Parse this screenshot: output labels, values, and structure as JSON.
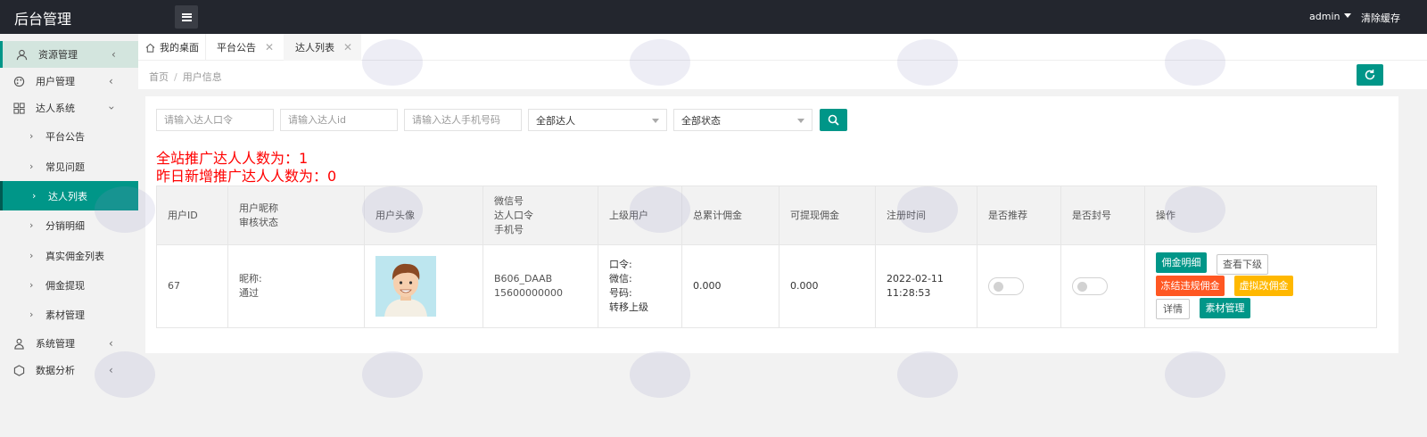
{
  "app": {
    "title": "后台管理",
    "user": "admin",
    "clear_cache": "清除缓存"
  },
  "sidebar": {
    "items": [
      {
        "label": "资源管理",
        "icon": "user-icon"
      },
      {
        "label": "用户管理",
        "icon": "palette-icon"
      },
      {
        "label": "达人系统",
        "icon": "grid-icon"
      }
    ],
    "sub_items": [
      {
        "label": "平台公告"
      },
      {
        "label": "常见问题"
      },
      {
        "label": "达人列表"
      },
      {
        "label": "分销明细"
      },
      {
        "label": "真实佣金列表"
      },
      {
        "label": "佣金提现"
      },
      {
        "label": "素材管理"
      }
    ],
    "bottom_items": [
      {
        "label": "系统管理",
        "icon": "person-icon"
      },
      {
        "label": "数据分析",
        "icon": "hexagon-icon"
      }
    ]
  },
  "tabs": [
    {
      "label": "我的桌面"
    },
    {
      "label": "平台公告"
    },
    {
      "label": "达人列表"
    }
  ],
  "breadcrumb": {
    "home": "首页",
    "current": "用户信息"
  },
  "filters": {
    "token_placeholder": "请输入达人口令",
    "id_placeholder": "请输入达人id",
    "phone_placeholder": "请输入达人手机号码",
    "type_select": "全部达人",
    "status_select": "全部状态"
  },
  "stats": {
    "total": "全站推广达人人数为：1",
    "yesterday": "昨日新增推广达人人数为：0"
  },
  "table": {
    "headers": {
      "user_id": "用户ID",
      "nickname_1": "用户昵称",
      "nickname_2": "审核状态",
      "avatar": "用户头像",
      "wx_1": "微信号",
      "wx_2": "达人口令",
      "wx_3": "手机号",
      "parent": "上级用户",
      "total": "总累计佣金",
      "withdrawable": "可提现佣金",
      "reg_time": "注册时间",
      "recommend": "是否推荐",
      "banned": "是否封号",
      "ops": "操作"
    },
    "rows": [
      {
        "user_id": "67",
        "nickname": "昵称:",
        "status": "通过",
        "token": "B606_DAAB",
        "phone": "15600000000",
        "parent_token": "口令:",
        "parent_wx": "微信:",
        "parent_phone": "号码:",
        "parent_transfer": "转移上级",
        "total": "0.000",
        "withdrawable": "0.000",
        "reg_date": "2022-02-11",
        "reg_time": "11:28:53",
        "recommend": false,
        "banned": false,
        "ops": {
          "commission_detail": "佣金明细",
          "view_sub": "查看下级",
          "freeze": "冻结违规佣金",
          "fake_edit": "虚拟改佣金",
          "detail": "详情",
          "material": "素材管理"
        }
      }
    ]
  },
  "colors": {
    "primary": "#009688",
    "danger": "#ff5722",
    "warn": "#ffb800",
    "topbar": "#23262e",
    "stat": "#ff0000"
  }
}
